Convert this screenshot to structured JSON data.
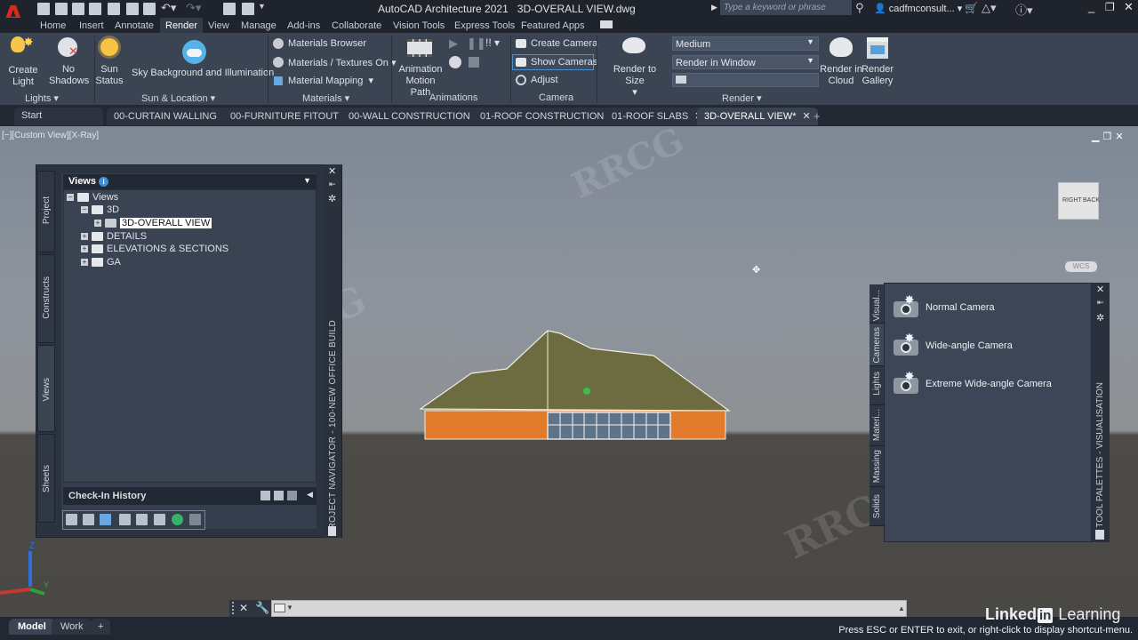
{
  "app": {
    "title": "AutoCAD Architecture 2021",
    "filename": "3D-OVERALL VIEW.dwg",
    "logo": "A",
    "search_placeholder": "Type a keyword or phrase",
    "user": "cadfmconsult...",
    "window_controls": [
      "minimize",
      "restore",
      "close"
    ]
  },
  "quick_access": [
    "new-icon",
    "open-icon",
    "save-icon",
    "save-as-icon",
    "publish-icon",
    "cloud-icon",
    "plot-icon",
    "undo-icon",
    "redo-icon",
    "workspace-icon",
    "properties-icon",
    "customize-icon"
  ],
  "menu_tabs": [
    "Home",
    "Insert",
    "Annotate",
    "Render",
    "View",
    "Manage",
    "Add-ins",
    "Collaborate",
    "Vision Tools",
    "Express Tools",
    "Featured Apps"
  ],
  "active_menu_tab": "Render",
  "ribbon": {
    "lights": {
      "label": "Lights",
      "create_light": "Create\nLight",
      "create_light_l1": "Create",
      "create_light_l2": "Light",
      "no_shadows_l1": "No",
      "no_shadows_l2": "Shadows"
    },
    "sun": {
      "label": "Sun & Location",
      "sun_status_l1": "Sun",
      "sun_status_l2": "Status",
      "sky": "Sky Background and Illumination"
    },
    "materials": {
      "label": "Materials",
      "browser": "Materials Browser",
      "textures": "Materials / Textures On",
      "mapping": "Material Mapping"
    },
    "animations": {
      "label": "Animations",
      "motion_l1": "Animation",
      "motion_l2": "Motion Path"
    },
    "camera": {
      "label": "Camera",
      "create": "Create Camera",
      "show": "Show  Cameras",
      "adjust": "Adjust"
    },
    "render": {
      "label": "Render",
      "render_to_size": "Render to Size",
      "quality": "Medium",
      "target": "Render in Window",
      "cloud_l1": "Render in",
      "cloud_l2": "Cloud",
      "gallery_l1": "Render",
      "gallery_l2": "Gallery"
    }
  },
  "file_tabs": [
    {
      "label": "Start",
      "closable": false
    },
    {
      "label": "00-CURTAIN WALLING",
      "closable": true
    },
    {
      "label": "00-FURNITURE FITOUT",
      "closable": true
    },
    {
      "label": "00-WALL CONSTRUCTION",
      "closable": true
    },
    {
      "label": "01-ROOF CONSTRUCTION",
      "closable": true
    },
    {
      "label": "01-ROOF SLABS",
      "closable": true
    },
    {
      "label": "3D-OVERALL VIEW*",
      "closable": true,
      "active": true
    }
  ],
  "close_glyph": "✕",
  "add_tab": "+",
  "viewport": {
    "label": "[−][Custom View][X-Ray]",
    "viewcube": {
      "face1": "RIGHT",
      "face2": "BACK"
    },
    "wcs": "WCS"
  },
  "project_navigator": {
    "title": "PROJECT NAVIGATOR - 100-NEW OFFICE BUILD",
    "side_tabs": [
      "Project",
      "Constructs",
      "Views",
      "Sheets"
    ],
    "active_side_tab": "Views",
    "views_header": "Views",
    "tree": [
      {
        "label": "Views",
        "level": 0,
        "expander": "−",
        "open": true
      },
      {
        "label": "3D",
        "level": 1,
        "expander": "−",
        "open": true
      },
      {
        "label": "3D-OVERALL VIEW",
        "level": 2,
        "expander": "+",
        "selected": true
      },
      {
        "label": "DETAILS",
        "level": 1,
        "expander": "+"
      },
      {
        "label": "ELEVATIONS & SECTIONS",
        "level": 1,
        "expander": "+"
      },
      {
        "label": "GA",
        "level": 1,
        "expander": "+"
      }
    ],
    "checkin_label": "Check-In History"
  },
  "tool_palette": {
    "title": "TOOL PALETTES - VISUALISATION",
    "tabs": [
      "Visual...",
      "Cameras",
      "Lights",
      "Materi...",
      "Massing",
      "Solids"
    ],
    "active_tab": "Cameras",
    "items": [
      "Normal Camera",
      "Wide-angle Camera",
      "Extreme Wide-angle Camera"
    ]
  },
  "layout_tabs": [
    "Model",
    "Work",
    "+"
  ],
  "active_layout": "Model",
  "status_message": "Press ESC or ENTER to exit, or right-click to display shortcut-menu.",
  "branding": {
    "linked": "Linked",
    "in": "in",
    "learning": "Learning"
  },
  "colors": {
    "brand_red": "#d52b1e",
    "ribbon_bg": "#3b4453",
    "brick": "#e07a2a",
    "roof": "#6f6a3e"
  }
}
